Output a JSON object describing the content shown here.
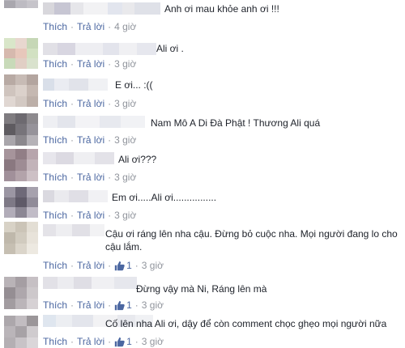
{
  "action_like": "Thích",
  "action_reply": "Trả lời",
  "separator": "·",
  "comments": [
    {
      "text": "Anh ơi mau khỏe anh ơi !!!",
      "time": "4 giờ"
    },
    {
      "text": "Ali ơi .",
      "time": "3 giờ"
    },
    {
      "text": "E ơi... :((",
      "time": "3 giờ"
    },
    {
      "text": "Nam Mô A Di Đà Phật ! Thương Ali quá",
      "time": "3 giờ"
    },
    {
      "text": "Ali ơi???",
      "time": "3 giờ"
    },
    {
      "text": "Em ơi.....Ali ơi................",
      "time": "3 giờ"
    },
    {
      "text": "Cậu ơi ráng lên nha cậu. Đừng bỏ cuộc nha. Mọi người đang lo cho cậu lắm.",
      "time": "3 giờ",
      "likes": "1"
    },
    {
      "text": "Đừng vậy mà Ni, Ráng lên mà",
      "time": "3 giờ",
      "likes": "1"
    },
    {
      "text": "Cố lên nha Ali ơi, dậy để còn comment chọc ghẹo mọi người nữa",
      "time": "3 giờ",
      "likes": "1"
    }
  ],
  "colors": {
    "link": "#4b67a1",
    "meta": "#90949c",
    "text": "#1d2129"
  }
}
